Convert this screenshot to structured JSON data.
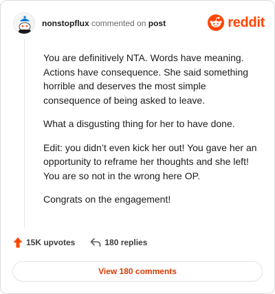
{
  "comment": {
    "username": "nonstopflux",
    "action": "commented on",
    "post_link": "post",
    "paragraphs": [
      "You are definitively NTA. Words have meaning. Actions have consequence. She said something horrible and deserves the most simple consequence of being asked to leave.",
      "What a disgusting thing for her to have done.",
      "Edit: you didn’t even kick her out! You gave her an opportunity to reframe her thoughts and she left! You are so not in the wrong here OP.",
      "Congrats on the engagement!"
    ]
  },
  "brand": {
    "name": "reddit",
    "color": "#ff4500",
    "icon": "reddit-snoo-icon"
  },
  "footer": {
    "upvotes": "15K upvotes",
    "upvote_icon": "upvote-arrow-icon",
    "upvote_color": "#ff4500",
    "replies": "180 replies",
    "reply_icon": "reply-arrow-icon"
  },
  "view_button": {
    "label": "View 180 comments",
    "color": "#d93900"
  },
  "avatar": {
    "icon": "snoo-avatar-icon",
    "accent": "#0079d3"
  }
}
